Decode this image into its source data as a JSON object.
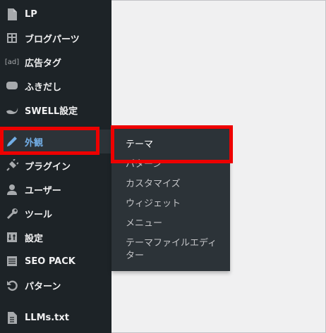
{
  "menu": {
    "items": [
      {
        "label": "LP",
        "icon": "page-icon"
      },
      {
        "label": "ブログパーツ",
        "icon": "blocks-icon"
      },
      {
        "label": "広告タグ",
        "icon": "ad-icon"
      },
      {
        "label": "ふきだし",
        "icon": "speech-bubble-icon"
      },
      {
        "label": "SWELL設定",
        "icon": "swell-icon"
      },
      {
        "label": "外観",
        "icon": "paintbrush-icon"
      },
      {
        "label": "プラグイン",
        "icon": "plugin-icon"
      },
      {
        "label": "ユーザー",
        "icon": "user-icon"
      },
      {
        "label": "ツール",
        "icon": "wrench-icon"
      },
      {
        "label": "設定",
        "icon": "settings-icon"
      },
      {
        "label": "SEO PACK",
        "icon": "list-icon"
      },
      {
        "label": "パターン",
        "icon": "undo-icon"
      },
      {
        "label": "LLMs.txt",
        "icon": "document-icon"
      }
    ],
    "ad_icon_text": "[ad]"
  },
  "submenu": {
    "items": [
      {
        "label": "テーマ"
      },
      {
        "label": "パターン"
      },
      {
        "label": "カスタマイズ"
      },
      {
        "label": "ウィジェット"
      },
      {
        "label": "メニュー"
      },
      {
        "label": "テーマファイルエディ\nター"
      }
    ]
  },
  "colors": {
    "sidebar": "#1d2327",
    "current": "#72aee6",
    "highlight": "#ee0000"
  }
}
